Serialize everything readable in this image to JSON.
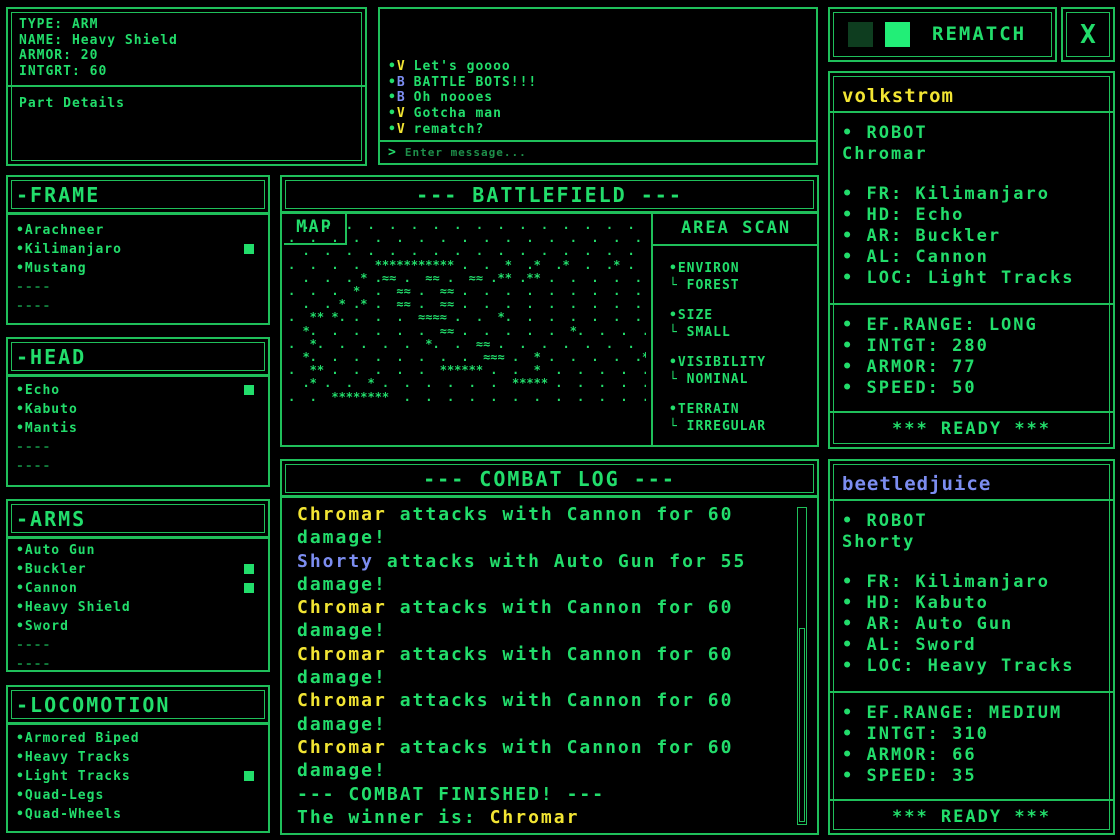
{
  "part_info": {
    "type": "TYPE: ARM",
    "name": "NAME: Heavy Shield",
    "armor": "ARMOR: 20",
    "intgrt": "INTGRT: 60",
    "details": "Part Details"
  },
  "chat": {
    "messages": [
      {
        "bullet": "•",
        "tag": "V",
        "text": "Let's goooo",
        "color": "#f2e533"
      },
      {
        "bullet": "•",
        "tag": "B",
        "text": "BATTLE BOTS!!!",
        "color": "#7c8df0"
      },
      {
        "bullet": "•",
        "tag": "B",
        "text": "Oh noooes",
        "color": "#7c8df0"
      },
      {
        "bullet": "•",
        "tag": "V",
        "text": "Gotcha man",
        "color": "#f2e533"
      },
      {
        "bullet": "•",
        "tag": "V",
        "text": "rematch?",
        "color": "#f2e533"
      }
    ],
    "prompt": ">",
    "placeholder": "Enter message..."
  },
  "top": {
    "rematch": "REMATCH",
    "close": "X"
  },
  "frame": {
    "title": "-FRAME",
    "items": [
      "Arachneer",
      "Kilimanjaro",
      "Mustang"
    ],
    "selected": 1,
    "empty": [
      "----",
      "----"
    ]
  },
  "head": {
    "title": "-HEAD",
    "items": [
      "Echo",
      "Kabuto",
      "Mantis"
    ],
    "selected": 0,
    "empty": [
      "----",
      "----"
    ]
  },
  "arms": {
    "title": "-ARMS",
    "items": [
      "Auto Gun",
      "Buckler",
      "Cannon",
      "Heavy Shield",
      "Sword"
    ],
    "selected": [
      1,
      2
    ],
    "empty": [
      "----",
      "----"
    ]
  },
  "locomotion": {
    "title": "-LOCOMOTION",
    "items": [
      "Armored Biped",
      "Heavy Tracks",
      "Light Tracks",
      "Quad-Legs",
      "Quad-Wheels"
    ],
    "selected": 2
  },
  "battlefield": {
    "title": "--- BATTLEFIELD ---",
    "map_label": "MAP",
    "area_scan": "AREA SCAN",
    "scan": [
      {
        "k": "VIRON",
        "p": "EN",
        "v": "FOREST"
      },
      {
        "k": "SIZE",
        "p": "",
        "v": "SMALL"
      },
      {
        "k": "VISIBILITY",
        "p": "",
        "v": "NOMINAL"
      },
      {
        "k": "TERRAIN",
        "p": "",
        "v": "IRREGULAR"
      }
    ],
    "map": [
      "  .  .  .  .  .  .  .  .  .  .  .  .  .  .  .  .  .  .  .  .  .",
      ".  .  .  .  .  .  .  .  .  .  .  .  .  .  .  .  .  . **  .  .  ",
      "  .  .  .  .  .  .  .  .  .  .  .  .  .  .  .  .  * . *** .  .",
      ".  .  .  .  *********** .  .  *  .*  .*  .  .* .  .  .  * .  ",
      "  .  .  . * .≈≈ .  ≈≈ .  ≈≈ .** .** .  .  .  .  .  .  .* .  .",
      ".  .  .  *  .  ≈≈ .  ≈≈ .  .  .  .  .  .  .  .  .  .  .  .  .",
      "  .  . * .* .  ≈≈ .  ≈≈ .  .  .  .  .  .  .  .  .  .  .  * .",
      ".  ** *. .  .  .  ≈≈≈≈ .  .  *.  .  .  .  .  .  .  .  *  .  ",
      "  *.  .  .  .  .  .  ≈≈ .  .  .  .  .  *.  .  .  .  .* .  .",
      ".  *.  .  .  .  .  *.  .  ≈≈ .  .  .  .  .  .  .  * .  .  .",
      "  *.  .  .  .  .  .  .  .  ≈≈≈ .  * .  .  .  .  .* .  .  .",
      ".  ** .  .  .  .  .  ****** .  .  *  .  .  .  .  .  .  .  .",
      "  .* .  .  * .  .  .  .  .  .  ***** .  .  .  .  .  .  .  .",
      ".  .  ********  .  .  .  .  .  .  .  .  .  .  .  .  .  .  ."
    ]
  },
  "combat": {
    "title": "--- COMBAT LOG ---",
    "lines": [
      {
        "who": "Chromar",
        "color": "#f2e533",
        "text": " attacks with Cannon for 60 damage!"
      },
      {
        "who": "Shorty",
        "color": "#7c8df0",
        "text": " attacks with Auto Gun for 55 damage!"
      },
      {
        "who": "Chromar",
        "color": "#f2e533",
        "text": " attacks with Cannon for 60 damage!"
      },
      {
        "who": "Chromar",
        "color": "#f2e533",
        "text": " attacks with Cannon for 60 damage!"
      },
      {
        "who": "Chromar",
        "color": "#f2e533",
        "text": " attacks with Cannon for 60 damage!"
      },
      {
        "who": "Chromar",
        "color": "#f2e533",
        "text": " attacks with Cannon for 60 damage!"
      }
    ],
    "finished": "--- COMBAT FINISHED! ---",
    "winner_prefix": "The winner is: ",
    "winner": "Chromar"
  },
  "player1": {
    "name": "volkstrom",
    "color": "#f2e533",
    "robot_label": "• ROBOT",
    "robot": "Chromar",
    "parts": [
      "• FR: Kilimanjaro",
      "• HD: Echo",
      "• AR: Buckler",
      "• AL: Cannon",
      "• LOC: Light Tracks"
    ],
    "stats": [
      "• EF.RANGE: LONG",
      "• INTGT: 280",
      "• ARMOR: 77",
      "• SPEED: 50"
    ],
    "ready": "*** READY ***"
  },
  "player2": {
    "name": "beetledjuice",
    "color": "#7c8df0",
    "robot_label": "• ROBOT",
    "robot": "Shorty",
    "parts": [
      "• FR: Kilimanjaro",
      "• HD: Kabuto",
      "• AR: Auto Gun",
      "• AL: Sword",
      "• LOC: Heavy Tracks"
    ],
    "stats": [
      "• EF.RANGE: MEDIUM",
      "• INTGT: 310",
      "• ARMOR: 66",
      "• SPEED: 35"
    ],
    "ready": "*** READY ***"
  }
}
